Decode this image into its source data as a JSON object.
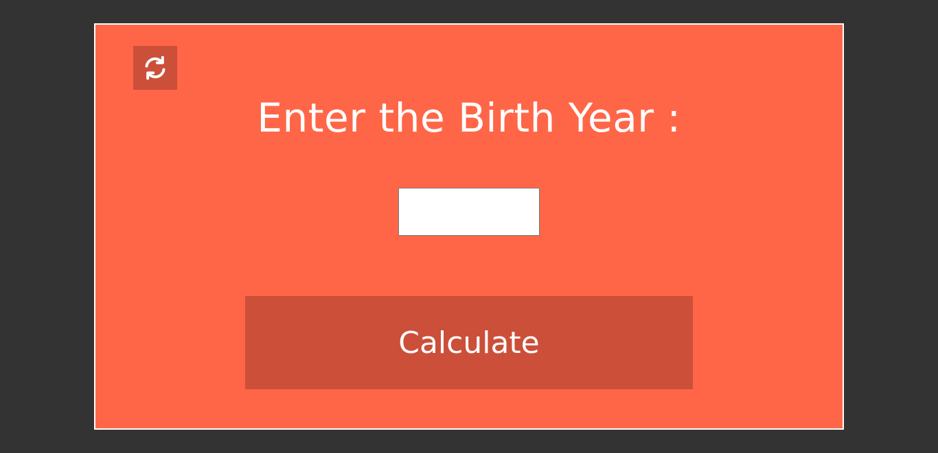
{
  "colors": {
    "page_background": "#333333",
    "card_background": "#ff6648",
    "card_border": "#ffffff",
    "button_background": "#cc4f39",
    "text": "#ffffff"
  },
  "reset": {
    "icon": "refresh-icon"
  },
  "form": {
    "heading": "Enter the Birth Year :",
    "year_value": "",
    "year_placeholder": ""
  },
  "calculate": {
    "label": "Calculate"
  }
}
